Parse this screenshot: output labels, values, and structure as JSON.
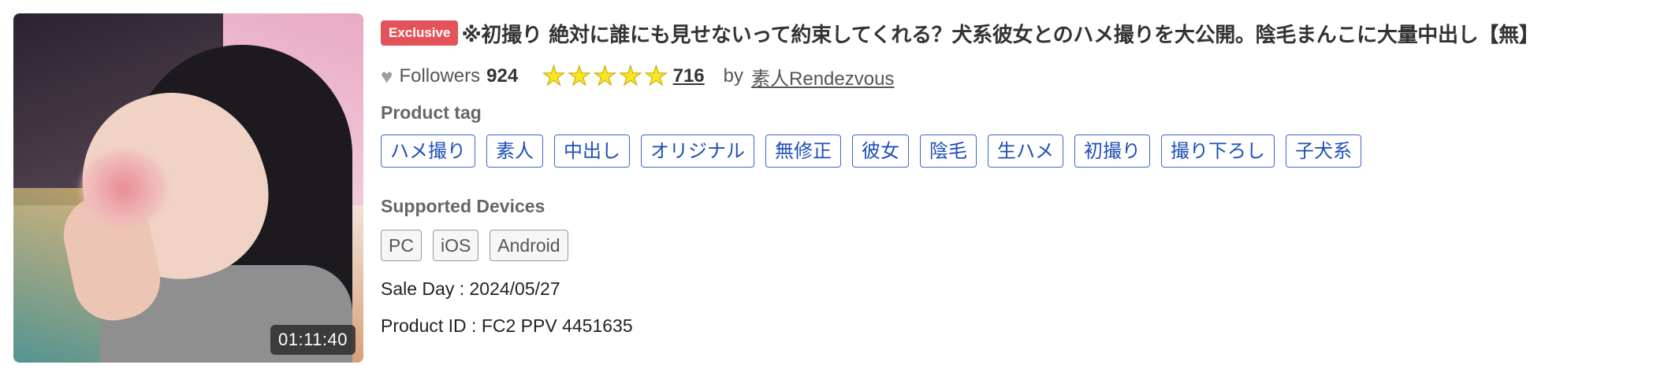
{
  "thumbnail": {
    "duration": "01:11:40"
  },
  "product": {
    "badge": "Exclusive",
    "title": "※初撮り 絶対に誰にも見せないって約束してくれる？犬系彼女とのハメ撮りを大公開。陰毛まんこに大量中出し【無】",
    "followers_label": "Followers",
    "followers_count": "924",
    "rating": {
      "stars": 5,
      "max": 5,
      "count": "716"
    },
    "by_label": "by",
    "seller": "素人Rendezvous"
  },
  "tags_section": {
    "label": "Product tag",
    "tags": [
      "ハメ撮り",
      "素人",
      "中出し",
      "オリジナル",
      "無修正",
      "彼女",
      "陰毛",
      "生ハメ",
      "初撮り",
      "撮り下ろし",
      "子犬系"
    ]
  },
  "devices_section": {
    "label": "Supported Devices",
    "devices": [
      "PC",
      "iOS",
      "Android"
    ]
  },
  "details": {
    "sale_day": "Sale Day : 2024/05/27",
    "product_id": "Product ID : FC2 PPV 4451635"
  },
  "icons": {
    "heart": "heart-icon",
    "star": "star-icon"
  },
  "colors": {
    "badge": "#e5535a",
    "tag_text": "#1e4fb8",
    "star": "#f6e51f",
    "heart": "#9e9e9e"
  }
}
